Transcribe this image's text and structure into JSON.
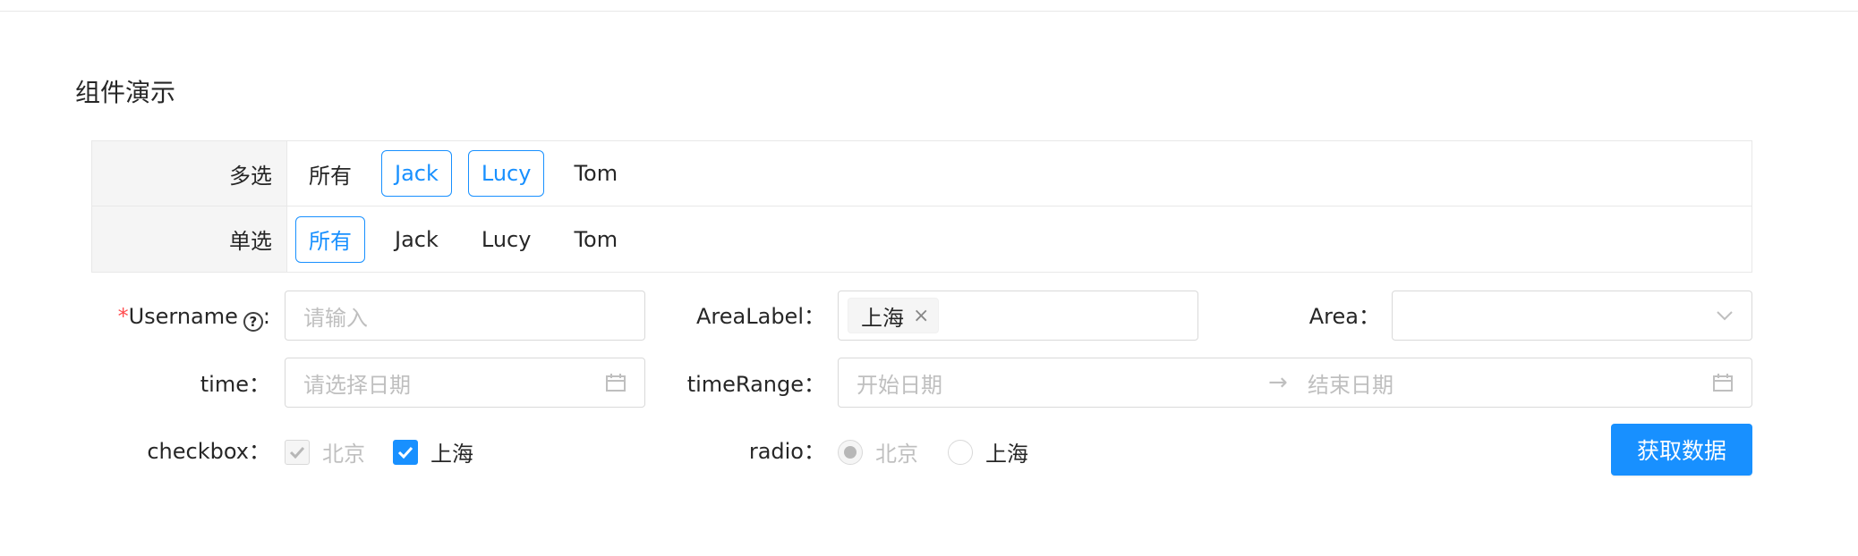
{
  "page": {
    "title": "组件演示"
  },
  "filters": {
    "multi": {
      "label": "多选",
      "options": [
        {
          "label": "所有",
          "checked": false
        },
        {
          "label": "Jack",
          "checked": true
        },
        {
          "label": "Lucy",
          "checked": true
        },
        {
          "label": "Tom",
          "checked": false
        }
      ]
    },
    "single": {
      "label": "单选",
      "options": [
        {
          "label": "所有",
          "checked": true
        },
        {
          "label": "Jack",
          "checked": false
        },
        {
          "label": "Lucy",
          "checked": false
        },
        {
          "label": "Tom",
          "checked": false
        }
      ]
    }
  },
  "form": {
    "username": {
      "required_mark": "*",
      "label": "Username",
      "help_icon": "question-circle-icon",
      "colon": ":",
      "placeholder": "请输入",
      "value": ""
    },
    "area_label": {
      "label": "AreaLabel",
      "colon": "：",
      "selected_tag": "上海",
      "tag_close": "×"
    },
    "area": {
      "label": "Area",
      "colon": "：",
      "value": "",
      "icon": "chevron-down-icon"
    },
    "time": {
      "label": "time",
      "colon": "：",
      "placeholder": "请选择日期",
      "icon": "calendar-icon"
    },
    "time_range": {
      "label": "timeRange",
      "colon": "：",
      "start_placeholder": "开始日期",
      "separator": "→",
      "end_placeholder": "结束日期",
      "icon": "calendar-icon"
    },
    "checkbox": {
      "label": "checkbox",
      "colon": "：",
      "options": [
        {
          "label": "北京",
          "checked": true,
          "disabled": true
        },
        {
          "label": "上海",
          "checked": true,
          "disabled": false
        }
      ]
    },
    "radio": {
      "label": "radio",
      "colon": "：",
      "options": [
        {
          "label": "北京",
          "checked": true,
          "disabled": true
        },
        {
          "label": "上海",
          "checked": false,
          "disabled": false
        }
      ]
    },
    "submit_button": "获取数据"
  },
  "colors": {
    "primary": "#1890ff",
    "required": "#ff4d4f",
    "border": "#d9d9d9",
    "placeholder": "#bfbfbf",
    "header_bg": "#f5f5f5"
  }
}
